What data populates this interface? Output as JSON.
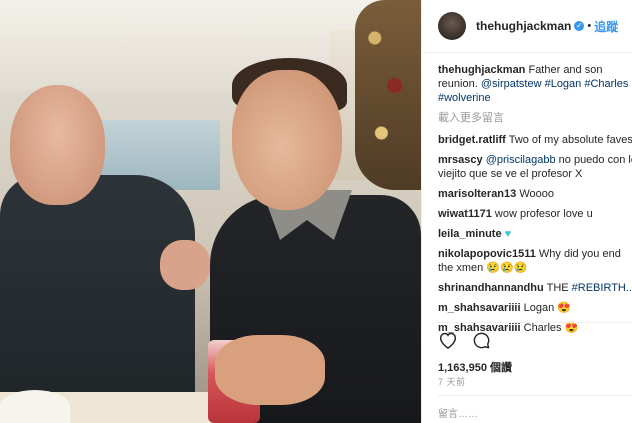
{
  "post": {
    "username": "thehughjackman",
    "follow_label": "追蹤",
    "dot": "•",
    "caption": {
      "user": "thehughjackman",
      "text": "Father and son reunion.",
      "mention": "@sirpatstew",
      "tags": [
        "#Logan",
        "#Charles",
        "#wolverine"
      ]
    },
    "load_more": "載入更多留言",
    "comments": [
      {
        "user": "bridget.ratliff",
        "text": "Two of my absolute faves!"
      },
      {
        "user": "mrsascy",
        "mention": "@priscilagabb",
        "text": "no puedo con lo viejito que se ve el profesor X"
      },
      {
        "user": "marisolteran13",
        "text": "Woooo"
      },
      {
        "user": "wiwat1171",
        "text": "wow profesor love u"
      },
      {
        "user": "leila_minute",
        "text": "♥"
      },
      {
        "user": "nikolapopovic1511",
        "text": "Why did you end the xmen",
        "emoji": "😢😢😢"
      },
      {
        "user": "shrinandhannandhu",
        "text": "THE",
        "tag": "#REBIRTH..."
      },
      {
        "user": "m_shahsavariiii",
        "text": "Logan",
        "emoji": "😍"
      },
      {
        "user": "m_shahsavariiii",
        "text": "Charles",
        "emoji": "😍"
      }
    ],
    "likes": "1,163,950 個讚",
    "time_ago": "7 天前",
    "add_comment_placeholder": "留言……"
  },
  "icons": {
    "like": "heart-icon",
    "comment": "comment-bubble-icon",
    "verified": "verified-badge-icon"
  },
  "colors": {
    "accent": "#3897f0",
    "link": "#003569",
    "muted": "#999999"
  }
}
